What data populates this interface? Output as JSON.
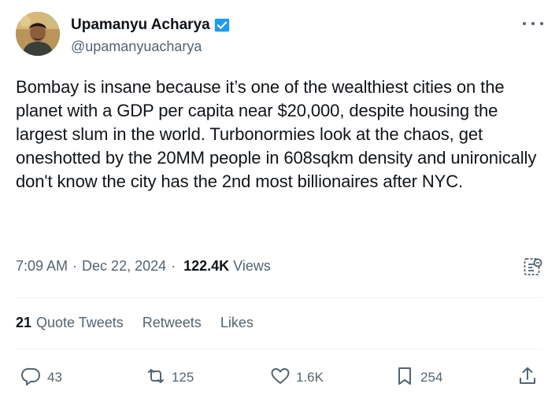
{
  "author": {
    "name": "Upamanyu Acharya",
    "handle": "@upamanyuacharya"
  },
  "tweet": {
    "text": "Bombay is insane because it’s one of the wealthiest cities on the planet with a GDP per capita near $20,000, despite housing the largest slum in the world. Turbonormies look at the chaos, get oneshotted by the 20MM people in 608sqkm density and unironically don't know the city has the 2nd most billionaires after NYC.",
    "time": "7:09 AM",
    "date": "Dec 22, 2024",
    "views_count": "122.4K",
    "views_label": "Views"
  },
  "stats": {
    "quote_count": "21",
    "quote_label": "Quote Tweets",
    "retweets_label": "Retweets",
    "likes_label": "Likes"
  },
  "actions": {
    "replies": "43",
    "retweets": "125",
    "likes": "1.6K",
    "bookmarks": "254"
  },
  "colors": {
    "text": "#0f1419",
    "secondary": "#536471",
    "verified": "#1d9bf0",
    "divider": "#eff3f4"
  },
  "icons": [
    "verified-badge-icon",
    "more-icon",
    "analytics-icon",
    "reply-icon",
    "retweet-icon",
    "like-icon",
    "bookmark-icon",
    "share-icon"
  ]
}
